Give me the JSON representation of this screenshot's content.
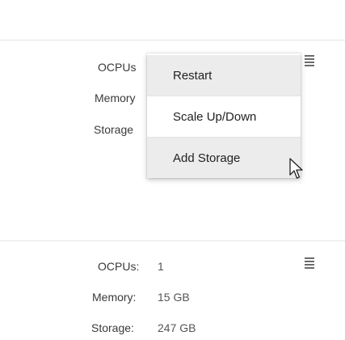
{
  "top_card": {
    "labels": {
      "ocpus": "OCPUs",
      "memory": "Memory",
      "storage": "Storage"
    },
    "actions_menu": {
      "items": [
        {
          "label": "Restart",
          "highlighted": true
        },
        {
          "label": "Scale Up/Down",
          "highlighted": false
        },
        {
          "label": "Add Storage",
          "highlighted": true
        }
      ]
    }
  },
  "bottom_card": {
    "ocpus_label": "OCPUs:",
    "ocpus_value": "1",
    "memory_label": "Memory:",
    "memory_value": "15 GB",
    "storage_label": "Storage:",
    "storage_value": "247 GB"
  },
  "icons": {
    "menu": "hamburger-menu-icon",
    "pointer": "mouse-pointer-icon"
  }
}
